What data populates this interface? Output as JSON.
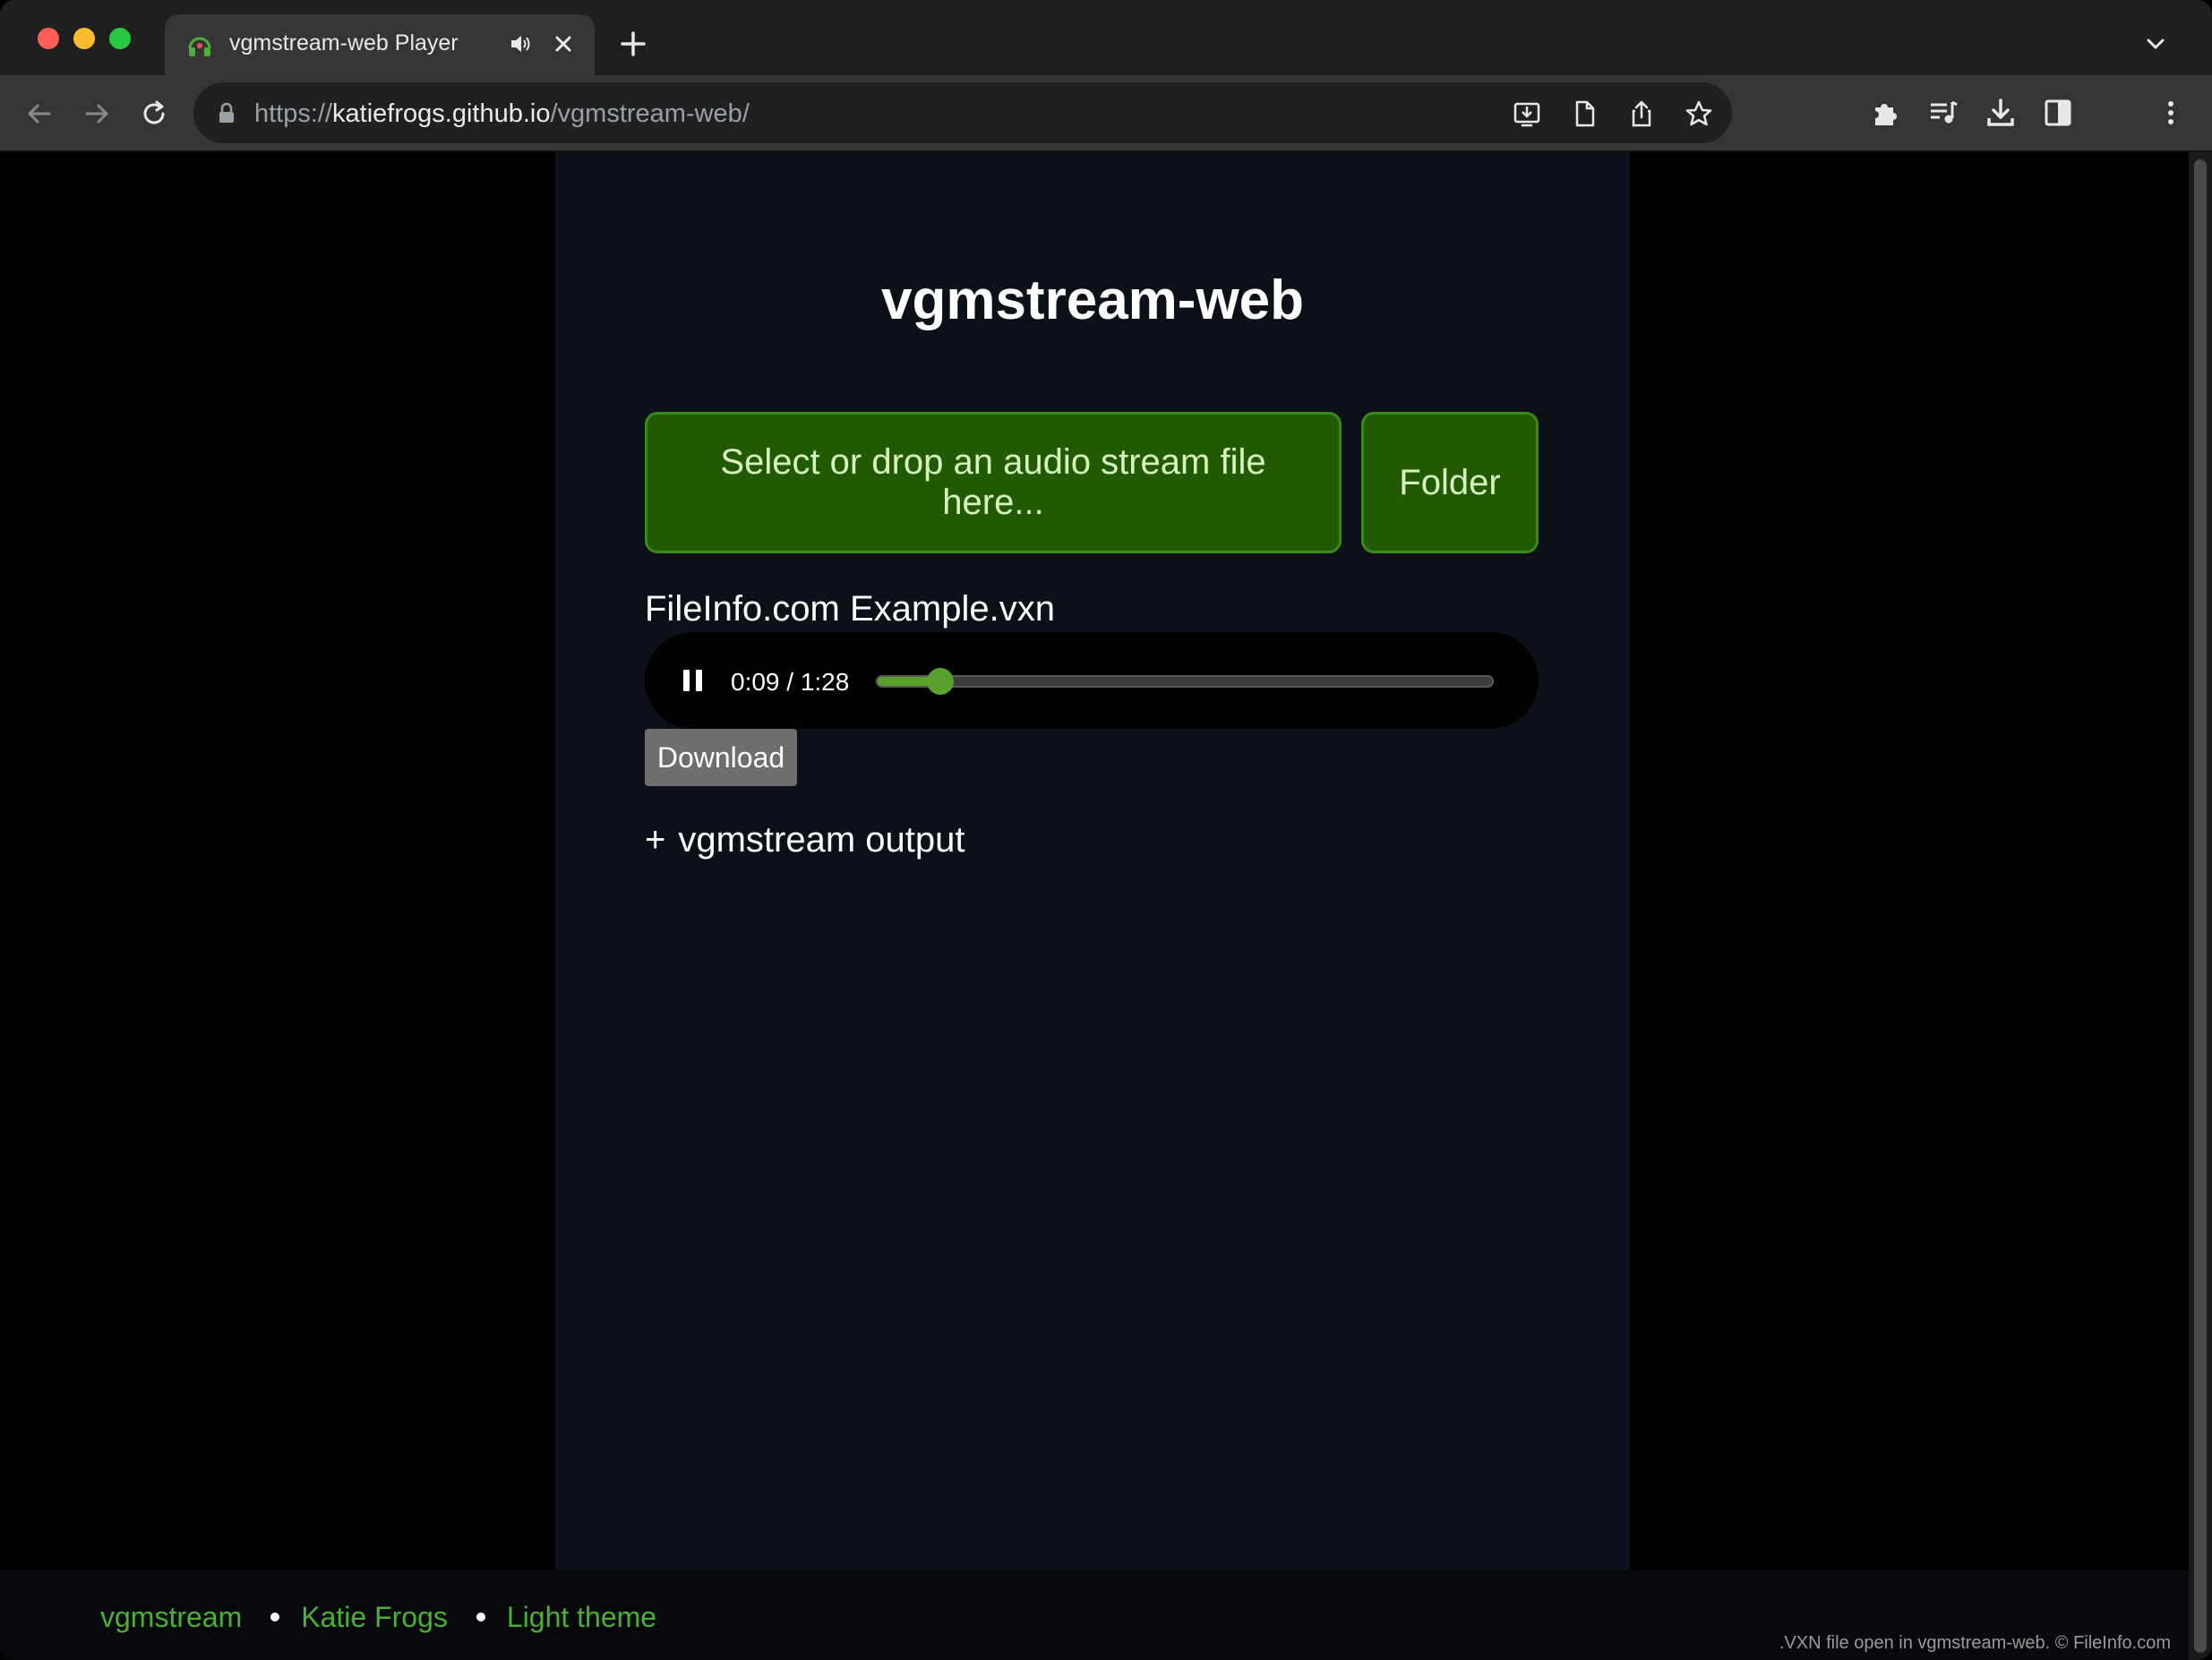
{
  "browser": {
    "tab": {
      "title": "vgmstream-web Player",
      "favicon": "headphones-icon",
      "audio_icon": "speaker-icon",
      "close_icon": "close-icon"
    },
    "url": {
      "scheme": "https://",
      "host": "katiefrogs.github.io",
      "path": "/vgmstream-web/"
    }
  },
  "page": {
    "title": "vgmstream-web",
    "select_button": "Select or drop an audio stream file here...",
    "folder_button": "Folder",
    "file_name": "FileInfo.com Example.vxn",
    "player": {
      "state": "playing",
      "time": "0:09 / 1:28",
      "progress": 0.102
    },
    "download_button": "Download",
    "output_toggle": {
      "symbol": "+",
      "label": "vgmstream output"
    }
  },
  "footer": {
    "links": [
      "vgmstream",
      "Katie Frogs",
      "Light theme"
    ],
    "credit": ".VXN file open in vgmstream-web. © FileInfo.com"
  },
  "colors": {
    "accent_green": "#215a00",
    "link_green": "#4caf36",
    "progress_green": "#5aa02c",
    "panel_bg": "#0c1018"
  }
}
